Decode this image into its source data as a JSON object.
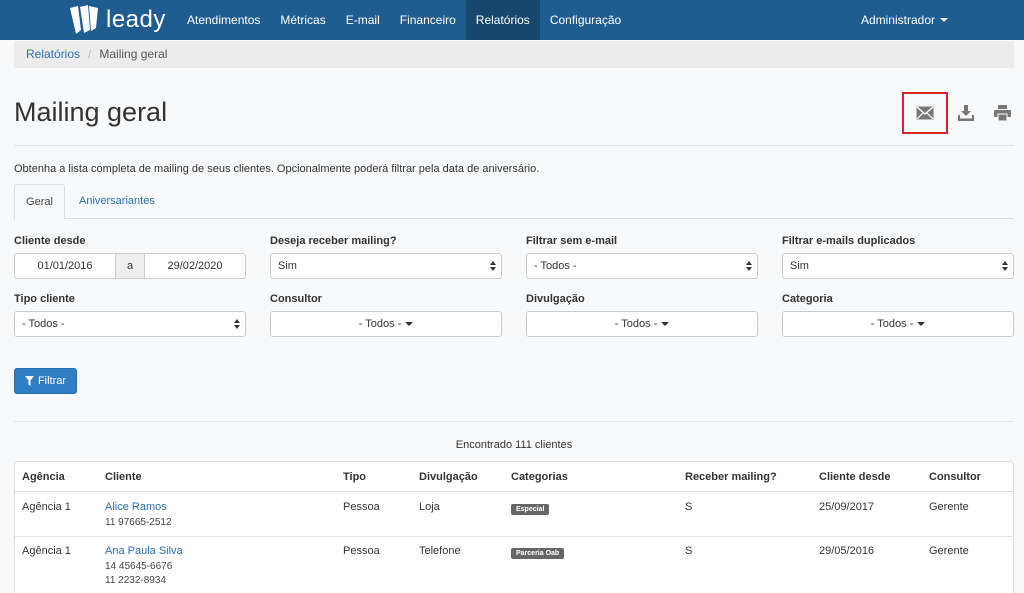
{
  "navbar": {
    "brand": "leady",
    "items": [
      "Atendimentos",
      "Métricas",
      "E-mail",
      "Financeiro",
      "Relatórios",
      "Configuração"
    ],
    "active": "Relatórios",
    "user": "Administrador"
  },
  "breadcrumb": {
    "parent": "Relatórios",
    "current": "Mailing geral"
  },
  "page": {
    "title": "Mailing geral",
    "description": "Obtenha a lista completa de mailing de seus clientes. Opcionalmente poderá filtrar pela data de aniversário."
  },
  "actions": [
    "email-icon",
    "download-icon",
    "print-icon"
  ],
  "tabs": [
    "Geral",
    "Aniversariantes"
  ],
  "filters": {
    "cliente_desde": {
      "label": "Cliente desde",
      "from": "01/01/2016",
      "sep": "a",
      "to": "29/02/2020"
    },
    "receber_mailing": {
      "label": "Deseja receber mailing?",
      "value": "Sim"
    },
    "sem_email": {
      "label": "Filtrar sem e-mail",
      "value": "- Todos -"
    },
    "duplicados": {
      "label": "Filtrar e-mails duplicados",
      "value": "Sim"
    },
    "tipo_cliente": {
      "label": "Tipo cliente",
      "value": "- Todos -"
    },
    "consultor": {
      "label": "Consultor",
      "value": "- Todos -"
    },
    "divulgacao": {
      "label": "Divulgação",
      "value": "- Todos -"
    },
    "categoria": {
      "label": "Categoria",
      "value": "- Todos -"
    },
    "button": "Filtrar"
  },
  "results": {
    "summary": "Encontrado 111 clientes",
    "columns": [
      "Agência",
      "Cliente",
      "Tipo",
      "Divulgação",
      "Categorias",
      "Receber mailing?",
      "Cliente desde",
      "Consultor"
    ],
    "rows": [
      {
        "agencia": "Agência 1",
        "cliente": "Alice Ramos",
        "phone1": "11 97665-2512",
        "phone2": "",
        "tipo": "Pessoa",
        "divulgacao": "Loja",
        "categoria": "Especial",
        "receber": "S",
        "desde": "25/09/2017",
        "consultor": "Gerente"
      },
      {
        "agencia": "Agência 1",
        "cliente": "Ana Paula Silva",
        "phone1": "14 45645-6676",
        "phone2": "11 2232-8934",
        "tipo": "Pessoa",
        "divulgacao": "Telefone",
        "categoria": "Parceria Oab",
        "receber": "S",
        "desde": "29/05/2016",
        "consultor": "Gerente"
      }
    ]
  },
  "colors": {
    "navbar": "#1f5c8f",
    "navbar_active": "#17466e",
    "link": "#2a6fb5",
    "primary_button": "#2f7dc3",
    "highlight_border": "#d9242a",
    "badge": "#666666"
  }
}
